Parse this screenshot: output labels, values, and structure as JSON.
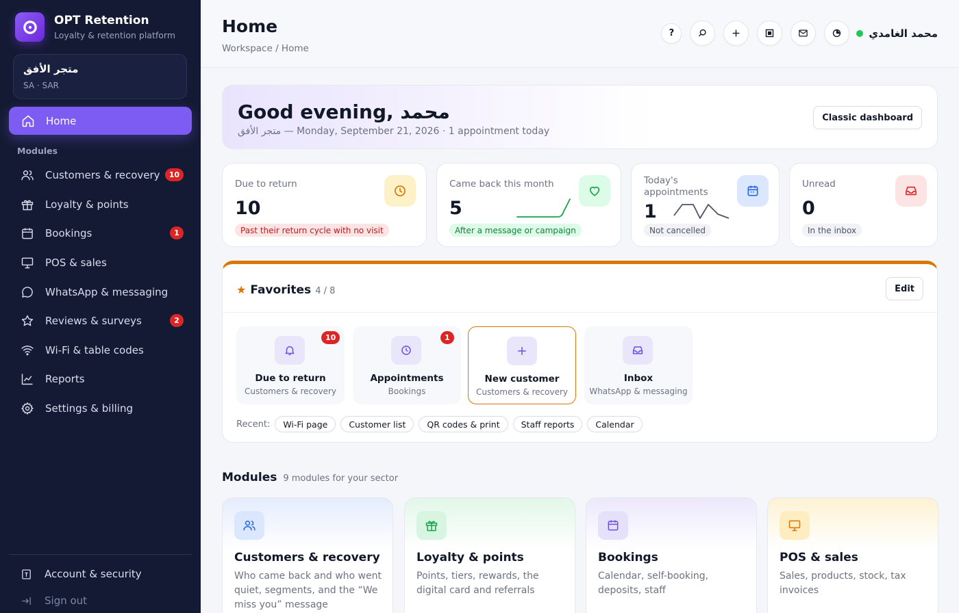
{
  "brand": {
    "title": "OPT Retention",
    "subtitle": "Loyalty & retention platform"
  },
  "store": {
    "name": "متجر الأفق",
    "meta": "SA · SAR"
  },
  "sidebar": {
    "home_label": "Home",
    "section_label": "Modules",
    "items": [
      {
        "label": "Customers & recovery",
        "badge": "10"
      },
      {
        "label": "Loyalty & points"
      },
      {
        "label": "Bookings",
        "badge": "1"
      },
      {
        "label": "POS & sales"
      },
      {
        "label": "WhatsApp & messaging"
      },
      {
        "label": "Reviews & surveys",
        "badge": "2"
      },
      {
        "label": "Wi-Fi & table codes"
      },
      {
        "label": "Reports"
      },
      {
        "label": "Settings & billing"
      }
    ],
    "account_label": "Account & security",
    "signout_label": "Sign out"
  },
  "header": {
    "title": "Home",
    "breadcrumb": "Workspace / Home",
    "help_label": "?",
    "user_name": "محمد الغامدي"
  },
  "greeting": {
    "title": "Good evening, محمد",
    "subtitle": "متجر الأفق — Monday, September 21, 2026 · 1 appointment today",
    "classic_button": "Classic dashboard"
  },
  "stats": [
    {
      "label": "Due to return",
      "value": "10",
      "tag": "Past their return cycle with no visit",
      "icon": "clock-icon",
      "color": "#d97706"
    },
    {
      "label": "Came back this month",
      "value": "5",
      "tag": "After a message or campaign",
      "icon": "heart-icon",
      "color": "#16a34a"
    },
    {
      "label": "Today's appointments",
      "value": "1",
      "tag": "Not cancelled",
      "icon": "calendar-icon",
      "color": "#2563eb"
    },
    {
      "label": "Unread",
      "value": "0",
      "tag": "In the inbox",
      "icon": "inbox-icon",
      "color": "#dc2626"
    }
  ],
  "favorites": {
    "title": "Favorites",
    "count": "4 / 8",
    "edit_label": "Edit",
    "tiles": [
      {
        "title": "Due to return",
        "subtitle": "Customers & recovery",
        "badge": "10",
        "icon": "bell-icon"
      },
      {
        "title": "Appointments",
        "subtitle": "Bookings",
        "badge": "1",
        "icon": "clock-icon"
      },
      {
        "title": "New customer",
        "subtitle": "Customers & recovery",
        "icon": "plus-icon"
      },
      {
        "title": "Inbox",
        "subtitle": "WhatsApp & messaging",
        "icon": "inbox-icon"
      }
    ],
    "recent_label": "Recent:",
    "recent": [
      "Wi-Fi page",
      "Customer list",
      "QR codes & print",
      "Staff reports",
      "Calendar"
    ]
  },
  "modules": {
    "title": "Modules",
    "subtitle": "9 modules for your sector",
    "cards": [
      {
        "title": "Customers & recovery",
        "desc": "Who came back and who went quiet, segments, and the “We miss you” message",
        "icon": "users-icon",
        "color": "#2563eb"
      },
      {
        "title": "Loyalty & points",
        "desc": "Points, tiers, rewards, the digital card and referrals",
        "icon": "gift-icon",
        "color": "#16a34a"
      },
      {
        "title": "Bookings",
        "desc": "Calendar, self-booking, deposits, staff",
        "icon": "calendar-icon",
        "color": "#6d4fe0"
      },
      {
        "title": "POS & sales",
        "desc": "Sales, products, stock, tax invoices",
        "icon": "monitor-icon",
        "color": "#d97706"
      }
    ]
  },
  "colors": {
    "accent": "#7c5cf2",
    "sidebar_bg": "#141a33",
    "favorites_border": "#d97706",
    "badge": "#dc2626"
  }
}
